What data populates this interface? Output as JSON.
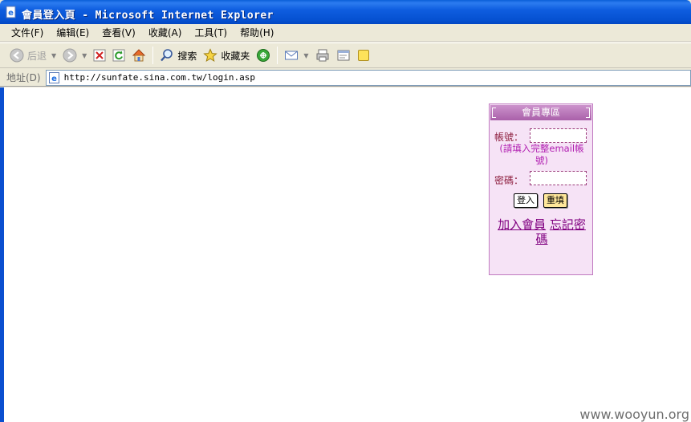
{
  "window": {
    "title": "會員登入頁 - Microsoft Internet Explorer"
  },
  "menu": {
    "items": [
      "文件(F)",
      "编辑(E)",
      "查看(V)",
      "收藏(A)",
      "工具(T)",
      "帮助(H)"
    ]
  },
  "toolbar": {
    "back_label": "后退",
    "search_label": "搜索",
    "favorites_label": "收藏夹"
  },
  "address": {
    "label": "地址(D)",
    "url": "http://sunfate.sina.com.tw/login.asp"
  },
  "login_box": {
    "header": "會員專區",
    "account_label": "帳號：",
    "hint": "(請填入完整email帳號)",
    "password_label": "密碼：",
    "login_button": "登入",
    "reset_button": "重填",
    "join_link": "加入會員",
    "forgot_link": "忘記密碼"
  },
  "watermark": "www.wooyun.org"
}
